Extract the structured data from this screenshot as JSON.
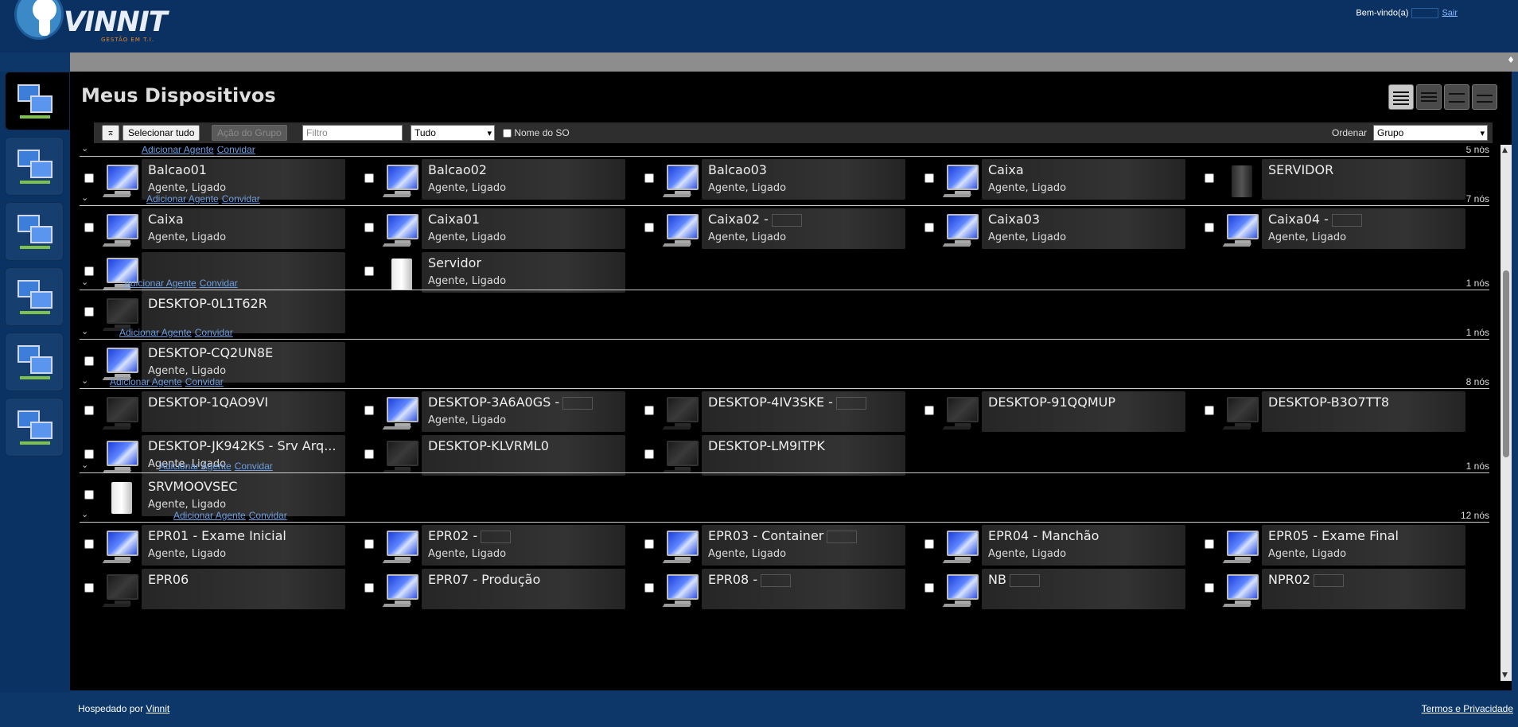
{
  "header": {
    "logo_word": "VINNIT",
    "logo_tagline": "GESTÃO EM T.I.",
    "welcome": "Bem-vindo(a)",
    "logout": "Sair"
  },
  "sidebar": {
    "items": [
      {
        "name": "devices",
        "icon": "network-computers-icon",
        "active": true
      },
      {
        "name": "monitors",
        "icon": "computer-monitors-icon",
        "active": false
      },
      {
        "name": "tasks",
        "icon": "gear-checklist-icon",
        "active": false
      },
      {
        "name": "support",
        "icon": "person-door-icon",
        "active": false
      },
      {
        "name": "users",
        "icon": "users-icon",
        "active": false
      },
      {
        "name": "security",
        "icon": "server-lock-icon",
        "active": false
      }
    ]
  },
  "main": {
    "title": "Meus Dispositivos",
    "toolbar": {
      "collapse_icon": "collapse-toggle-icon",
      "select_all": "Selecionar tudo",
      "group_action": "Ação do Grupo",
      "filter_placeholder": "Filtro",
      "filter_value": "",
      "type_select": "Tudo",
      "os_name_label": "Nome do SO",
      "order_label": "Ordenar",
      "order_select": "Grupo"
    },
    "groups": [
      {
        "links": [
          "Adicionar Agente",
          "Convidar"
        ],
        "count": "5 nós",
        "devices": [
          {
            "name": "Balcao01",
            "status": "Agente, Ligado",
            "icon": "monitor-on"
          },
          {
            "name": "Balcao02",
            "status": "Agente, Ligado",
            "icon": "monitor-on"
          },
          {
            "name": "Balcao03",
            "status": "Agente, Ligado",
            "icon": "monitor-on"
          },
          {
            "name": "Caixa",
            "status": "Agente, Ligado",
            "icon": "monitor-on"
          },
          {
            "name": "SERVIDOR",
            "status": "",
            "icon": "tower-dark"
          }
        ]
      },
      {
        "links": [
          "Adicionar Agente",
          "Convidar"
        ],
        "count": "7 nós",
        "devices": [
          {
            "name": "Caixa",
            "status": "Agente, Ligado",
            "icon": "monitor-on"
          },
          {
            "name": "Caixa01",
            "status": "Agente, Ligado",
            "icon": "monitor-on"
          },
          {
            "name": "Caixa02 -",
            "status": "Agente, Ligado",
            "icon": "monitor-on",
            "box": true
          },
          {
            "name": "Caixa03",
            "status": "Agente, Ligado",
            "icon": "monitor-on"
          },
          {
            "name": "Caixa04 -",
            "status": "Agente, Ligado",
            "icon": "monitor-on",
            "box": true
          },
          {
            "name": "",
            "status": "",
            "icon": "monitor-on"
          },
          {
            "name": "Servidor",
            "status": "Agente, Ligado",
            "icon": "tower-light"
          }
        ]
      },
      {
        "links": [
          "Adicionar Agente",
          "Convidar"
        ],
        "count": "1 nós",
        "devices": [
          {
            "name": "DESKTOP-0L1T62R",
            "status": "",
            "icon": "monitor-off"
          }
        ]
      },
      {
        "links": [
          "Adicionar Agente",
          "Convidar"
        ],
        "count": "1 nós",
        "devices": [
          {
            "name": "DESKTOP-CQ2UN8E",
            "status": "Agente, Ligado",
            "icon": "monitor-on"
          }
        ]
      },
      {
        "links": [
          "Adicionar Agente",
          "Convidar"
        ],
        "count": "8 nós",
        "devices": [
          {
            "name": "DESKTOP-1QAO9VI",
            "status": "",
            "icon": "monitor-off"
          },
          {
            "name": "DESKTOP-3A6A0GS -",
            "status": "Agente, Ligado",
            "icon": "monitor-on",
            "box": true
          },
          {
            "name": "DESKTOP-4IV3SKE -",
            "status": "",
            "icon": "monitor-off",
            "box": true
          },
          {
            "name": "DESKTOP-91QQMUP",
            "status": "",
            "icon": "monitor-off"
          },
          {
            "name": "DESKTOP-B3O7TT8",
            "status": "",
            "icon": "monitor-off"
          },
          {
            "name": "DESKTOP-JK942KS - Srv Arq...",
            "status": "Agente, Ligado",
            "icon": "monitor-on"
          },
          {
            "name": "DESKTOP-KLVRML0",
            "status": "",
            "icon": "monitor-off"
          },
          {
            "name": "DESKTOP-LM9ITPK",
            "status": "",
            "icon": "monitor-off"
          }
        ]
      },
      {
        "links": [
          "Adicionar Agente",
          "Convidar"
        ],
        "count": "1 nós",
        "devices": [
          {
            "name": "SRVMOOVSEC",
            "status": "Agente, Ligado",
            "icon": "tower-light"
          }
        ]
      },
      {
        "links": [
          "Adicionar Agente",
          "Convidar"
        ],
        "count": "12 nós",
        "devices": [
          {
            "name": "EPR01 - Exame Inicial",
            "status": "Agente, Ligado",
            "icon": "monitor-on"
          },
          {
            "name": "EPR02 -",
            "status": "Agente, Ligado",
            "icon": "monitor-on",
            "box": true
          },
          {
            "name": "EPR03 - Container",
            "status": "Agente, Ligado",
            "icon": "monitor-on",
            "box": true
          },
          {
            "name": "EPR04 - Manchão",
            "status": "Agente, Ligado",
            "icon": "monitor-on"
          },
          {
            "name": "EPR05 - Exame Final",
            "status": "Agente, Ligado",
            "icon": "monitor-on"
          },
          {
            "name": "EPR06",
            "status": "",
            "icon": "monitor-off"
          },
          {
            "name": "EPR07 - Produção",
            "status": "",
            "icon": "monitor-on"
          },
          {
            "name": "EPR08 -",
            "status": "",
            "icon": "monitor-on",
            "box": true
          },
          {
            "name": "NB",
            "status": "",
            "icon": "monitor-on",
            "box": true
          },
          {
            "name": "NPR02",
            "status": "",
            "icon": "monitor-on",
            "box": true
          }
        ]
      }
    ]
  },
  "footer": {
    "hosted_by": "Hospedado por",
    "host_link": "Vinnit",
    "terms": "Termos e Privacidade"
  }
}
